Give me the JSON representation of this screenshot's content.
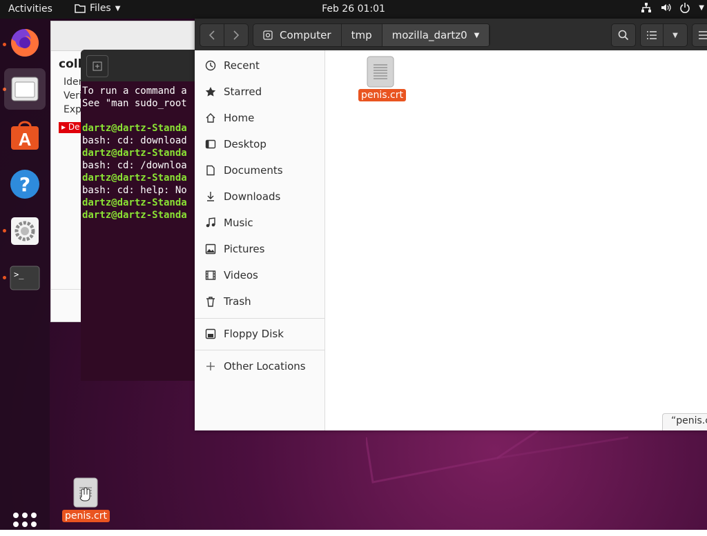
{
  "topbar": {
    "activities": "Activities",
    "app_menu": "Files",
    "clock": "Feb 26  01:01"
  },
  "dock": {
    "items": [
      "firefox-icon",
      "files-icon",
      "software-icon",
      "help-icon",
      "settings-icon",
      "terminal-icon"
    ]
  },
  "back_window": {
    "title": "colla",
    "rows": [
      "Iden",
      "Veri",
      "Exp"
    ],
    "warn": "De"
  },
  "terminal": {
    "lines": [
      {
        "text": "To run a command a",
        "green": false
      },
      {
        "text": "See \"man sudo_root",
        "green": false
      },
      {
        "text": "",
        "green": false
      },
      {
        "text": "dartz@dartz-Standa",
        "green": true
      },
      {
        "text": "bash: cd: download",
        "green": false
      },
      {
        "text": "dartz@dartz-Standa",
        "green": true
      },
      {
        "text": "bash: cd: /downloa",
        "green": false
      },
      {
        "text": "dartz@dartz-Standa",
        "green": true
      },
      {
        "text": "bash: cd: help: No",
        "green": false
      },
      {
        "text": "dartz@dartz-Standa",
        "green": true
      },
      {
        "text": "dartz@dartz-Standa",
        "green": true
      }
    ]
  },
  "files": {
    "path": [
      "Computer",
      "tmp",
      "mozilla_dartz0"
    ],
    "sidebar": {
      "items": [
        "Recent",
        "Starred",
        "Home",
        "Desktop",
        "Documents",
        "Downloads",
        "Music",
        "Pictures",
        "Videos",
        "Trash"
      ],
      "devices": [
        "Floppy Disk"
      ],
      "other": "Other Locations"
    },
    "file_name": "penis.crt",
    "status": "“penis.c"
  },
  "desktop": {
    "file_name": "penis.crt"
  },
  "colors": {
    "accent": "#e95420",
    "terminal_bg": "#300a24",
    "prompt_green": "#8ae234"
  }
}
